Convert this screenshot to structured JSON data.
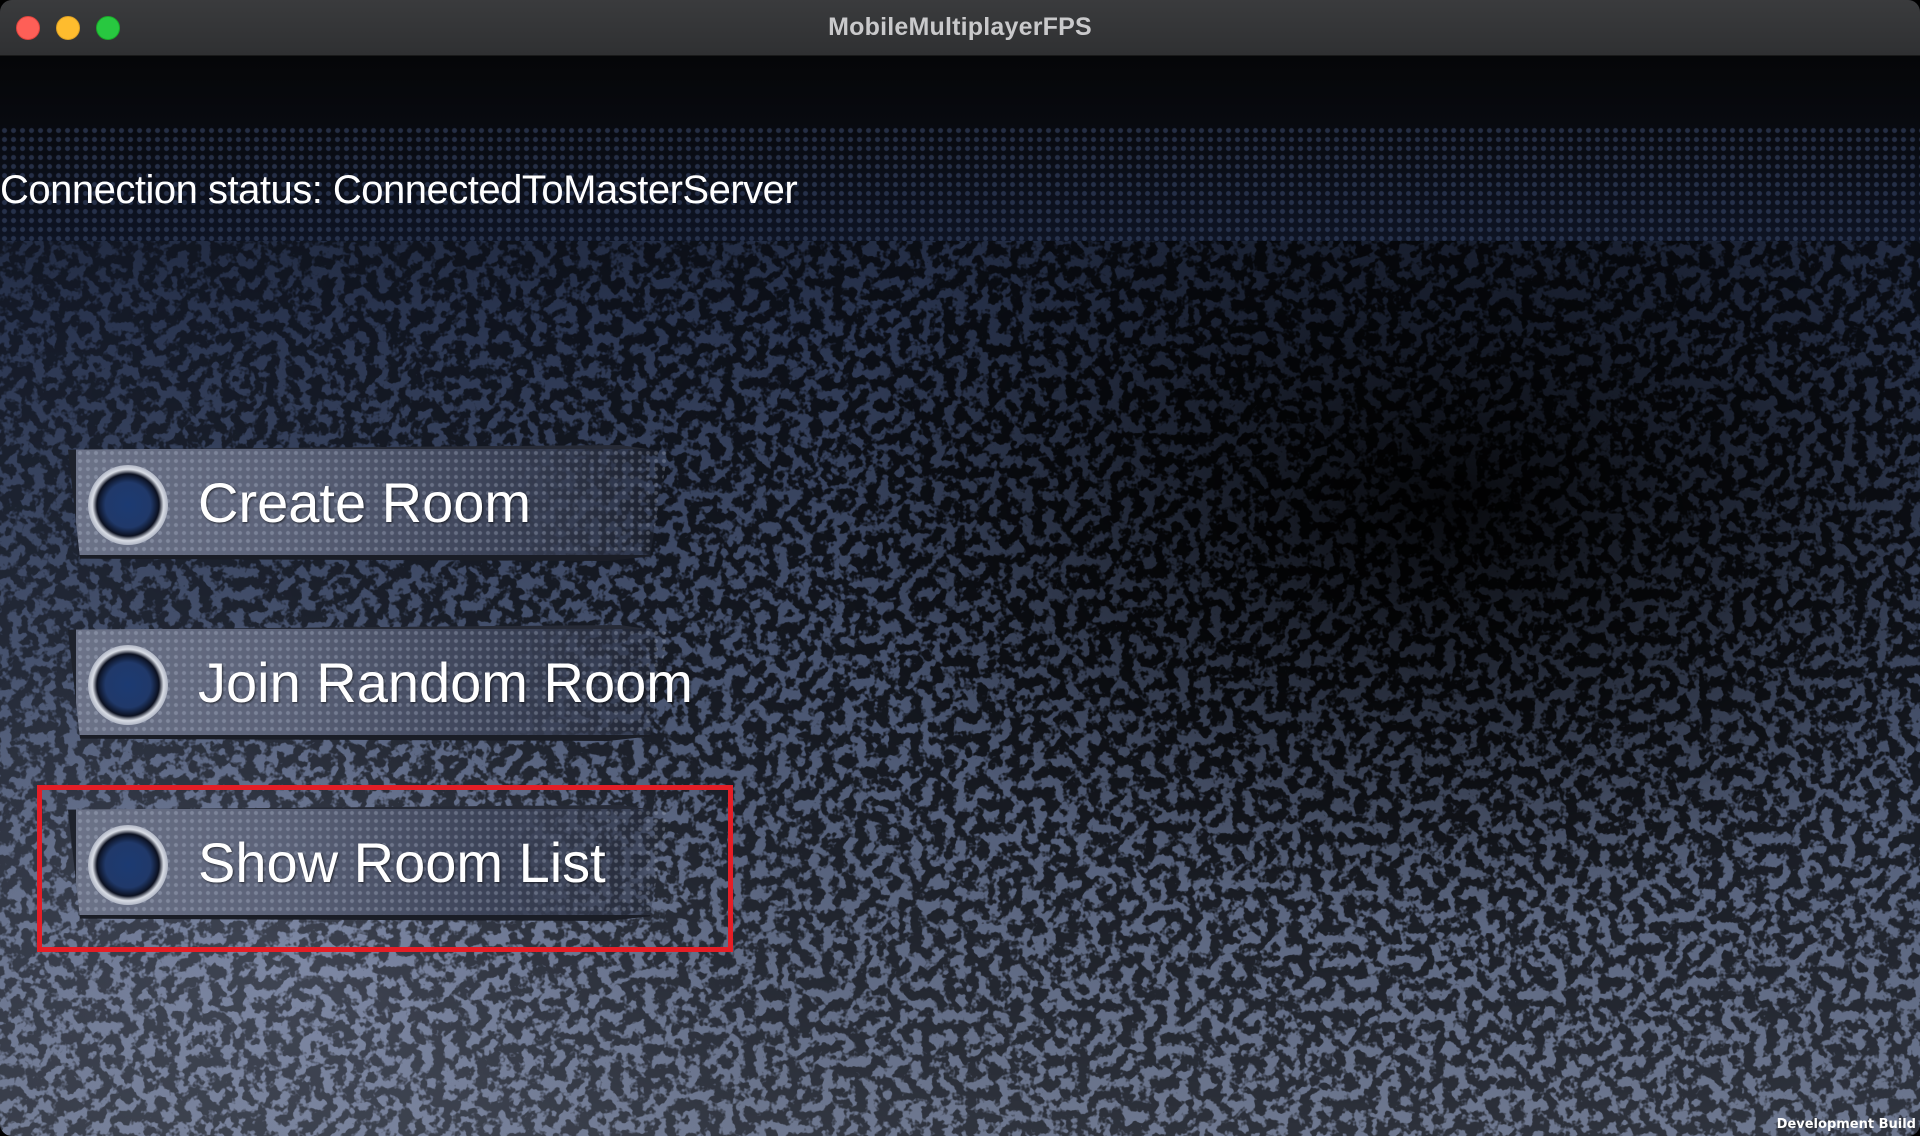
{
  "window": {
    "title": "MobileMultiplayerFPS",
    "controls": {
      "close_icon": "close-icon",
      "minimize_icon": "minimize-icon",
      "maximize_icon": "maximize-icon"
    }
  },
  "game": {
    "connection_status": "Connection status: ConnectedToMasterServer",
    "menu": {
      "create_room": "Create Room",
      "join_random_room": "Join Random Room",
      "show_room_list": "Show Room List"
    },
    "build_label": "Development Build"
  },
  "colors": {
    "highlight": "#e41e26",
    "close": "#fe5f57",
    "minimize": "#febc2e",
    "maximize": "#28c840"
  }
}
